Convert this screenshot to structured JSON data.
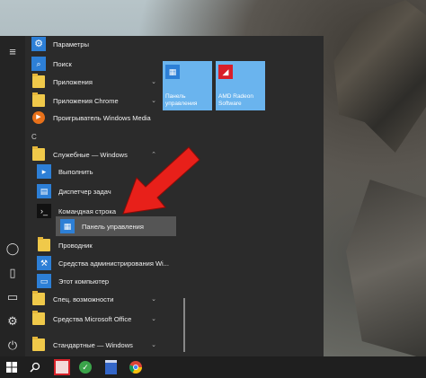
{
  "rail": {
    "icons": [
      "hamburger-icon",
      "user-icon",
      "document-icon",
      "pictures-icon",
      "gear-icon",
      "power-icon"
    ]
  },
  "apps": {
    "settings": "Параметры",
    "search": "Поиск",
    "applications": "Приложения",
    "chrome_apps": "Приложения Chrome",
    "media_player": "Проигрыватель Windows Media",
    "letter_c": "С",
    "system_tools": "Служебные — Windows",
    "run": "Выполнить",
    "task_manager": "Диспетчер задач",
    "cmd": "Командная строка",
    "control_panel": "Панель управления",
    "explorer": "Проводник",
    "admin_tools": "Средства администрирования Wi...",
    "this_pc": "Этот компьютер",
    "accessibility": "Спец. возможности",
    "office_tools": "Средства Microsoft Office",
    "standard": "Стандартные — Windows"
  },
  "tiles": {
    "control_panel": "Панель\nуправления",
    "amd": "AMD Radeon\nSoftware"
  },
  "taskbar": {
    "icons": [
      "windows-start-icon",
      "search-icon",
      "app-red-icon",
      "app-green-icon",
      "app-save-icon",
      "chrome-icon"
    ]
  },
  "colors": {
    "accent": "#2d7fd6",
    "tile": "#6ab4ee",
    "menu_bg": "#2b2b2b",
    "arrow": "#e8201a"
  }
}
